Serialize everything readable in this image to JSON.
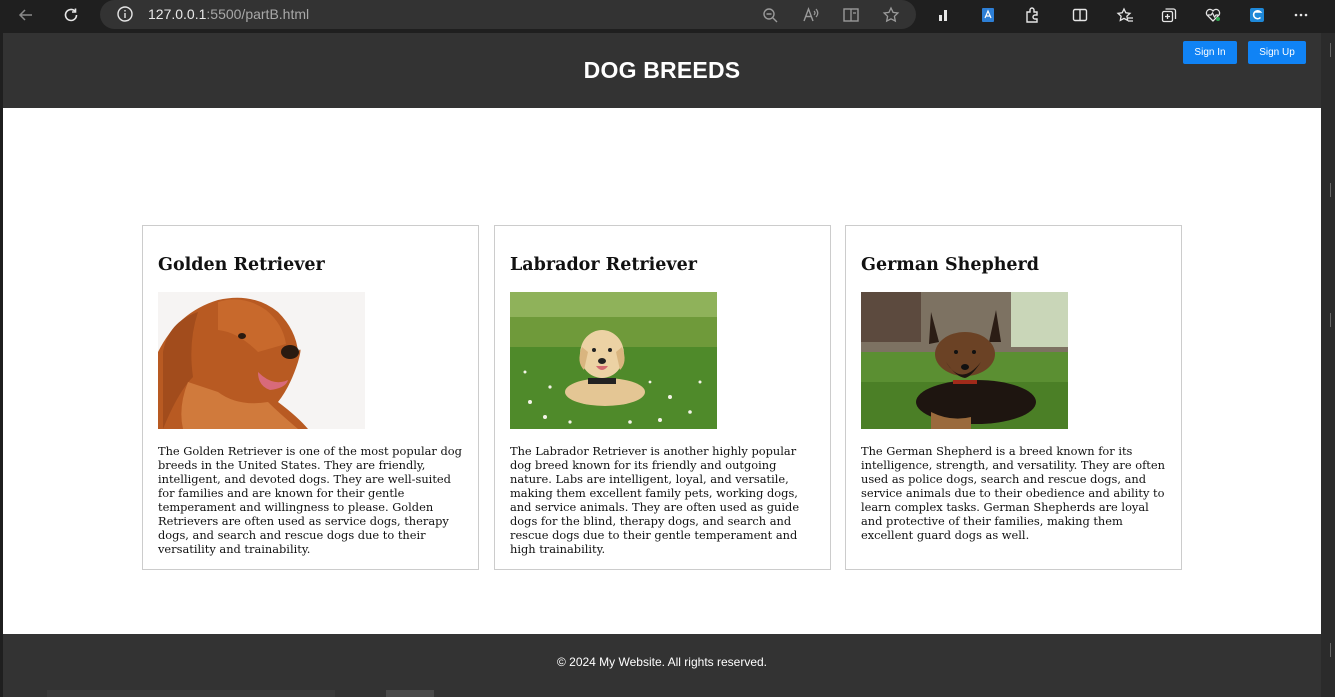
{
  "browser": {
    "url_host": "127.0.0.1",
    "url_rest": ":5500/partB.html",
    "icons": [
      "back-icon",
      "refresh-icon",
      "info-icon",
      "zoom-out-icon",
      "read-aloud-icon",
      "immersive-reader-icon",
      "favorite-star-icon",
      "stats-icon",
      "translate-icon",
      "extensions-icon",
      "split-screen-icon",
      "favorites-icon",
      "collections-icon",
      "health-icon",
      "edge-icon",
      "more-icon"
    ]
  },
  "header": {
    "title": "DOG BREEDS",
    "sign_in": "Sign In",
    "sign_up": "Sign Up"
  },
  "cards": [
    {
      "title": "Golden Retriever",
      "description": "The Golden Retriever is one of the most popular dog breeds in the United States. They are friendly, intelligent, and devoted dogs. They are well-suited for families and are known for their gentle temperament and willingness to please. Golden Retrievers are often used as service dogs, therapy dogs, and search and rescue dogs due to their versatility and trainability."
    },
    {
      "title": "Labrador Retriever",
      "description": "The Labrador Retriever is another highly popular dog breed known for its friendly and outgoing nature. Labs are intelligent, loyal, and versatile, making them excellent family pets, working dogs, and service animals. They are often used as guide dogs for the blind, therapy dogs, and search and rescue dogs due to their gentle temperament and high trainability."
    },
    {
      "title": "German Shepherd",
      "description": "The German Shepherd is a breed known for its intelligence, strength, and versatility. They are often used as police dogs, search and rescue dogs, and service animals due to their obedience and ability to learn complex tasks. German Shepherds are loyal and protective of their families, making them excellent guard dogs as well."
    }
  ],
  "footer": {
    "text": "© 2024 My Website. All rights reserved."
  },
  "colors": {
    "header_bg": "#333333",
    "button_blue": "#1083f5",
    "browser_bg": "#1f1f1f"
  }
}
